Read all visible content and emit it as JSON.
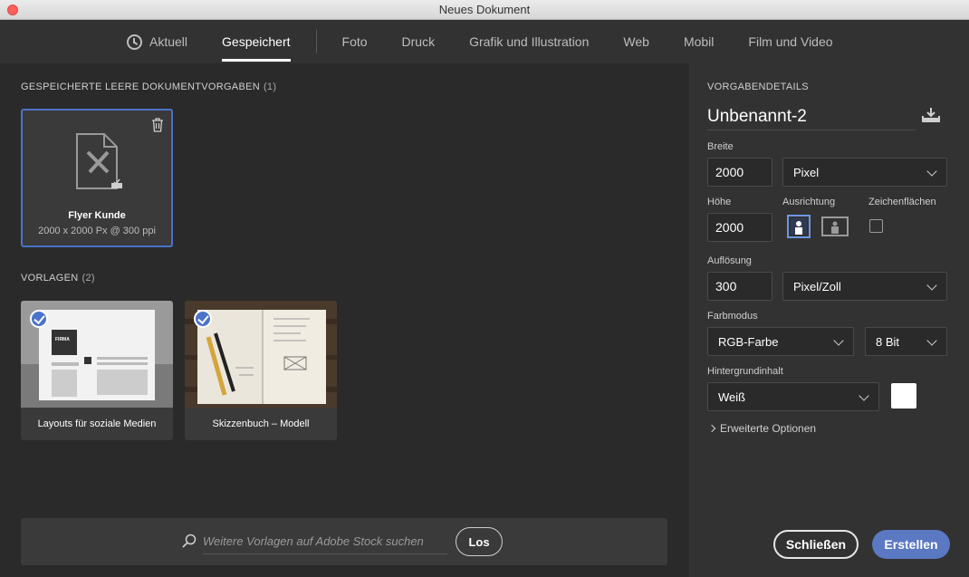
{
  "window": {
    "title": "Neues Dokument"
  },
  "tabs": [
    {
      "label": "Aktuell",
      "icon": "clock-icon"
    },
    {
      "label": "Gespeichert",
      "active": true
    },
    {
      "label": "Foto"
    },
    {
      "label": "Druck"
    },
    {
      "label": "Grafik und Illustration"
    },
    {
      "label": "Web"
    },
    {
      "label": "Mobil"
    },
    {
      "label": "Film und Video"
    }
  ],
  "saved": {
    "heading": "GESPEICHERTE LEERE DOKUMENTVORGABEN",
    "count": "(1)",
    "preset": {
      "name": "Flyer Kunde",
      "size": "2000 x 2000 Px @ 300 ppi"
    }
  },
  "templates": {
    "heading": "VORLAGEN",
    "count": "(2)",
    "items": [
      {
        "label": "Layouts für soziale Medien",
        "thumb_logo": "FIRMA"
      },
      {
        "label": "Skizzenbuch – Modell"
      }
    ]
  },
  "search": {
    "placeholder": "Weitere Vorlagen auf Adobe Stock suchen",
    "button": "Los"
  },
  "details": {
    "heading": "VORGABENDETAILS",
    "name": "Unbenannt-2",
    "width_label": "Breite",
    "width": "2000",
    "unit": "Pixel",
    "height_label": "Höhe",
    "height": "2000",
    "orientation_label": "Ausrichtung",
    "artboards_label": "Zeichenflächen",
    "resolution_label": "Auflösung",
    "resolution": "300",
    "resolution_unit": "Pixel/Zoll",
    "colormode_label": "Farbmodus",
    "colormode": "RGB-Farbe",
    "bitdepth": "8 Bit",
    "background_label": "Hintergrundinhalt",
    "background": "Weiß",
    "advanced": "Erweiterte Optionen"
  },
  "buttons": {
    "close": "Schließen",
    "create": "Erstellen"
  },
  "colors": {
    "accent": "#4b73c9",
    "create_button": "#5b78c2",
    "panel": "#323232",
    "background": "#2a2a2a"
  }
}
